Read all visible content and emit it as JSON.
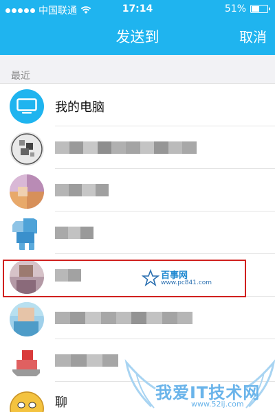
{
  "status_bar": {
    "carrier": "中国联通",
    "time": "17:14",
    "battery_text": "51%",
    "battery_level": 0.51
  },
  "nav": {
    "title": "发送到",
    "cancel_label": "取消"
  },
  "section": {
    "recent_label": "最近"
  },
  "list": {
    "items": [
      {
        "label": "我的电脑",
        "icon": "computer-icon"
      }
    ],
    "partial_label": "聊"
  },
  "watermarks": {
    "site1_title": "百事网",
    "site1_url": "www.pc841.com",
    "site2_title": "我爱IT技术网",
    "site2_url": "www.52ij.com"
  },
  "colors": {
    "accent": "#1fb4ef",
    "highlight": "#d0201e"
  }
}
